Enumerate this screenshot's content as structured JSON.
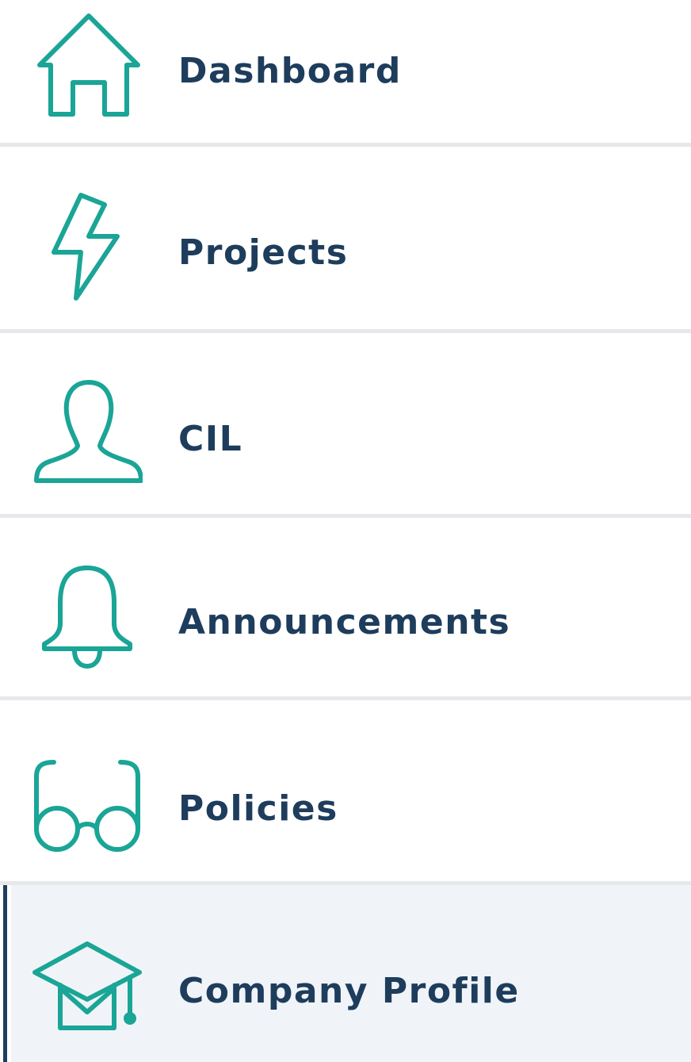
{
  "nav": {
    "accent_color": "#1aa596",
    "text_color": "#1e3d5c",
    "items": [
      {
        "label": "Dashboard",
        "icon": "home-icon",
        "active": false
      },
      {
        "label": "Projects",
        "icon": "lightning-bolt-icon",
        "active": false
      },
      {
        "label": "CIL",
        "icon": "user-icon",
        "active": false
      },
      {
        "label": "Announcements",
        "icon": "bell-icon",
        "active": false
      },
      {
        "label": "Policies",
        "icon": "glasses-icon",
        "active": false
      },
      {
        "label": "Company Profile",
        "icon": "graduation-cap-icon",
        "active": true
      }
    ]
  }
}
